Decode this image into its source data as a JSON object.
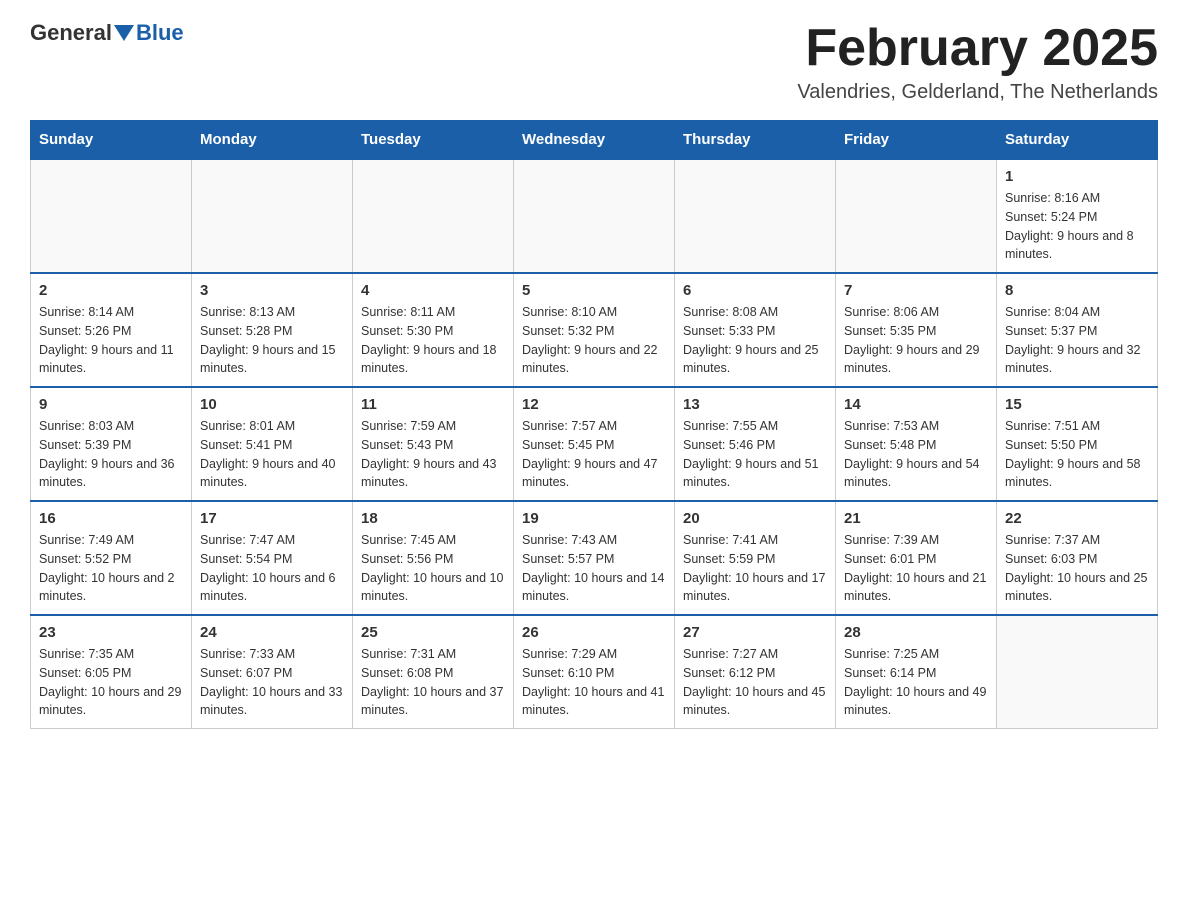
{
  "header": {
    "logo_general": "General",
    "logo_blue": "Blue",
    "month_title": "February 2025",
    "location": "Valendries, Gelderland, The Netherlands"
  },
  "weekdays": [
    "Sunday",
    "Monday",
    "Tuesday",
    "Wednesday",
    "Thursday",
    "Friday",
    "Saturday"
  ],
  "weeks": [
    [
      {
        "day": "",
        "info": ""
      },
      {
        "day": "",
        "info": ""
      },
      {
        "day": "",
        "info": ""
      },
      {
        "day": "",
        "info": ""
      },
      {
        "day": "",
        "info": ""
      },
      {
        "day": "",
        "info": ""
      },
      {
        "day": "1",
        "info": "Sunrise: 8:16 AM\nSunset: 5:24 PM\nDaylight: 9 hours and 8 minutes."
      }
    ],
    [
      {
        "day": "2",
        "info": "Sunrise: 8:14 AM\nSunset: 5:26 PM\nDaylight: 9 hours and 11 minutes."
      },
      {
        "day": "3",
        "info": "Sunrise: 8:13 AM\nSunset: 5:28 PM\nDaylight: 9 hours and 15 minutes."
      },
      {
        "day": "4",
        "info": "Sunrise: 8:11 AM\nSunset: 5:30 PM\nDaylight: 9 hours and 18 minutes."
      },
      {
        "day": "5",
        "info": "Sunrise: 8:10 AM\nSunset: 5:32 PM\nDaylight: 9 hours and 22 minutes."
      },
      {
        "day": "6",
        "info": "Sunrise: 8:08 AM\nSunset: 5:33 PM\nDaylight: 9 hours and 25 minutes."
      },
      {
        "day": "7",
        "info": "Sunrise: 8:06 AM\nSunset: 5:35 PM\nDaylight: 9 hours and 29 minutes."
      },
      {
        "day": "8",
        "info": "Sunrise: 8:04 AM\nSunset: 5:37 PM\nDaylight: 9 hours and 32 minutes."
      }
    ],
    [
      {
        "day": "9",
        "info": "Sunrise: 8:03 AM\nSunset: 5:39 PM\nDaylight: 9 hours and 36 minutes."
      },
      {
        "day": "10",
        "info": "Sunrise: 8:01 AM\nSunset: 5:41 PM\nDaylight: 9 hours and 40 minutes."
      },
      {
        "day": "11",
        "info": "Sunrise: 7:59 AM\nSunset: 5:43 PM\nDaylight: 9 hours and 43 minutes."
      },
      {
        "day": "12",
        "info": "Sunrise: 7:57 AM\nSunset: 5:45 PM\nDaylight: 9 hours and 47 minutes."
      },
      {
        "day": "13",
        "info": "Sunrise: 7:55 AM\nSunset: 5:46 PM\nDaylight: 9 hours and 51 minutes."
      },
      {
        "day": "14",
        "info": "Sunrise: 7:53 AM\nSunset: 5:48 PM\nDaylight: 9 hours and 54 minutes."
      },
      {
        "day": "15",
        "info": "Sunrise: 7:51 AM\nSunset: 5:50 PM\nDaylight: 9 hours and 58 minutes."
      }
    ],
    [
      {
        "day": "16",
        "info": "Sunrise: 7:49 AM\nSunset: 5:52 PM\nDaylight: 10 hours and 2 minutes."
      },
      {
        "day": "17",
        "info": "Sunrise: 7:47 AM\nSunset: 5:54 PM\nDaylight: 10 hours and 6 minutes."
      },
      {
        "day": "18",
        "info": "Sunrise: 7:45 AM\nSunset: 5:56 PM\nDaylight: 10 hours and 10 minutes."
      },
      {
        "day": "19",
        "info": "Sunrise: 7:43 AM\nSunset: 5:57 PM\nDaylight: 10 hours and 14 minutes."
      },
      {
        "day": "20",
        "info": "Sunrise: 7:41 AM\nSunset: 5:59 PM\nDaylight: 10 hours and 17 minutes."
      },
      {
        "day": "21",
        "info": "Sunrise: 7:39 AM\nSunset: 6:01 PM\nDaylight: 10 hours and 21 minutes."
      },
      {
        "day": "22",
        "info": "Sunrise: 7:37 AM\nSunset: 6:03 PM\nDaylight: 10 hours and 25 minutes."
      }
    ],
    [
      {
        "day": "23",
        "info": "Sunrise: 7:35 AM\nSunset: 6:05 PM\nDaylight: 10 hours and 29 minutes."
      },
      {
        "day": "24",
        "info": "Sunrise: 7:33 AM\nSunset: 6:07 PM\nDaylight: 10 hours and 33 minutes."
      },
      {
        "day": "25",
        "info": "Sunrise: 7:31 AM\nSunset: 6:08 PM\nDaylight: 10 hours and 37 minutes."
      },
      {
        "day": "26",
        "info": "Sunrise: 7:29 AM\nSunset: 6:10 PM\nDaylight: 10 hours and 41 minutes."
      },
      {
        "day": "27",
        "info": "Sunrise: 7:27 AM\nSunset: 6:12 PM\nDaylight: 10 hours and 45 minutes."
      },
      {
        "day": "28",
        "info": "Sunrise: 7:25 AM\nSunset: 6:14 PM\nDaylight: 10 hours and 49 minutes."
      },
      {
        "day": "",
        "info": ""
      }
    ]
  ]
}
